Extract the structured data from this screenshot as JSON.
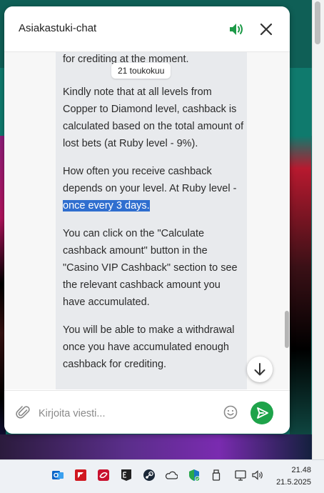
{
  "chat": {
    "title": "Asiakastuki-chat",
    "date_chip": "21 toukokuu",
    "messages": {
      "partial_line": "for crediting at the moment.",
      "para1": "Kindly note that at all levels from Copper to Diamond level, cashback is calculated based on the total amount of lost bets (at Ruby level - 9%).",
      "para2_before": "How often you receive cashback depends on your level. At Ruby level -",
      "para2_highlight": " once every 3 days.",
      "para3": "You can click on the \"Calculate cashback amount\" button in the \"Casino VIP Cashback\" section to see the relevant cashback amount you have accumulated.",
      "para4": "You will be able to make a withdrawal once you have accumulated enough cashback for crediting."
    },
    "composer": {
      "placeholder": "Kirjoita viesti..."
    },
    "colors": {
      "accent": "#1ea34a",
      "bubble": "#e8eaed",
      "highlight": "#2f6ecf"
    }
  },
  "taskbar": {
    "time": "21.48",
    "date": "21.5.2025",
    "icons": [
      "outlook-icon",
      "amd-icon",
      "amd-software-icon",
      "epic-games-icon",
      "steam-icon",
      "onedrive-icon",
      "defender-icon",
      "usb-icon",
      "network-icon",
      "volume-icon"
    ]
  }
}
